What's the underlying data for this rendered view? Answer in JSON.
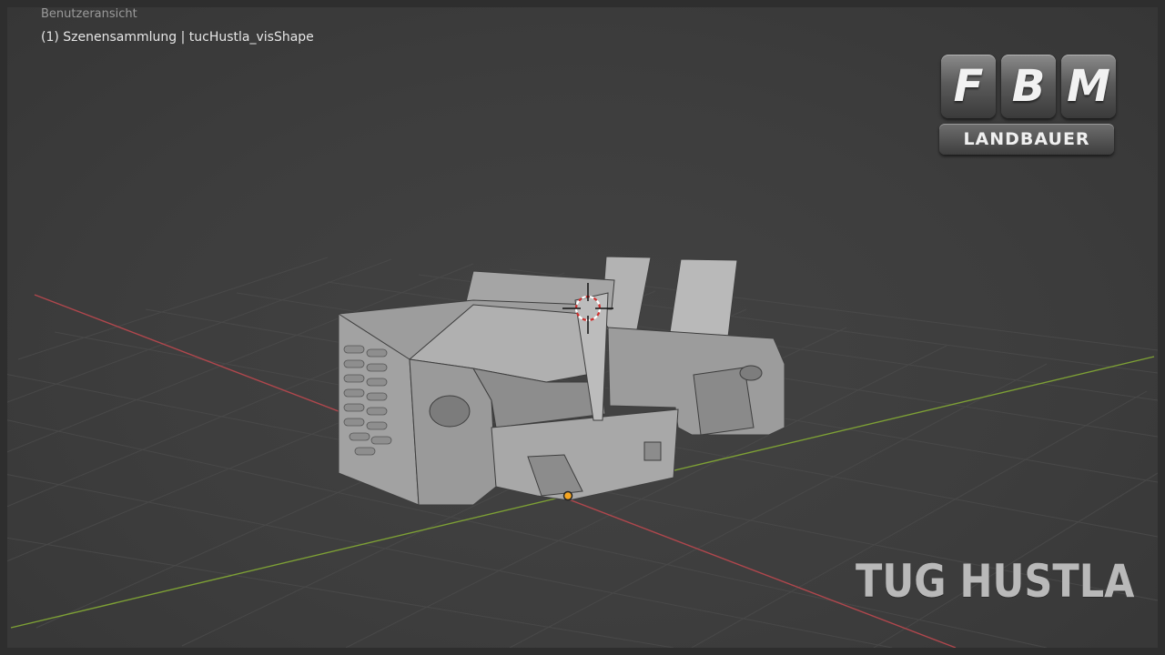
{
  "viewport": {
    "view_name": "Benutzeransicht",
    "scene_info": "(1) Szenensammlung | tucHustla_visShape"
  },
  "axes": {
    "x_color": "#b0474d",
    "y_color": "#7ea135"
  },
  "origin_color": "#f5a623",
  "logo": {
    "letters": [
      "F",
      "B",
      "M"
    ],
    "subtitle": "LANDBAUER"
  },
  "overlay_title": "TUG HUSTLA",
  "icons": [
    "3d-cursor-icon",
    "origin-dot-icon"
  ]
}
